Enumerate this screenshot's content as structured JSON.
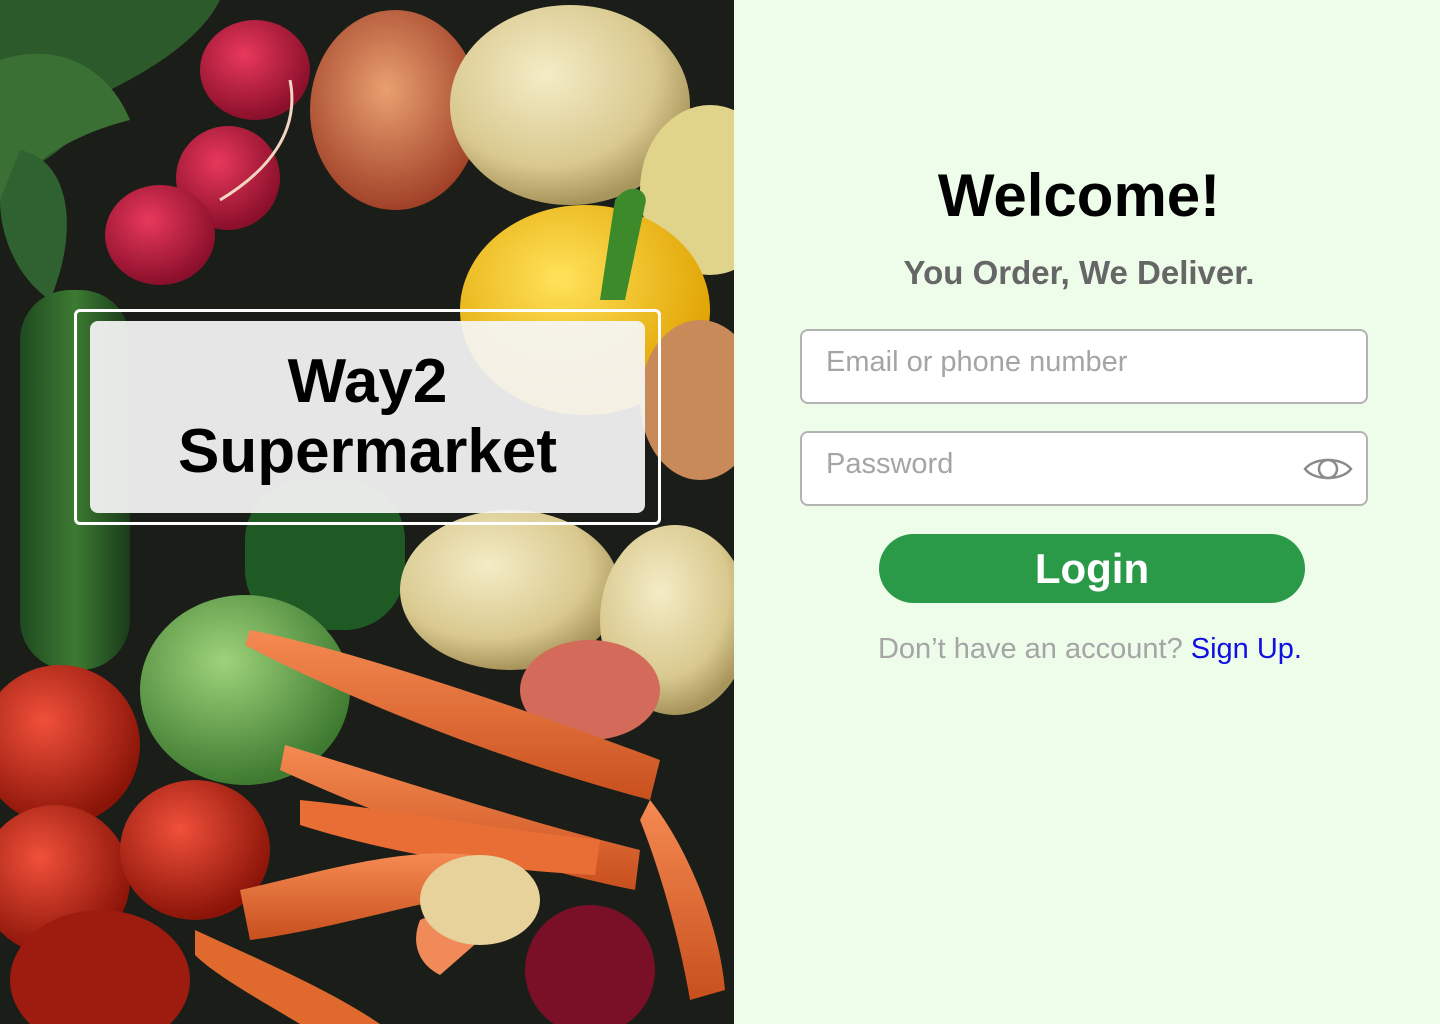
{
  "brand": {
    "line1": "Way2",
    "line2": "Supermarket"
  },
  "hero": {
    "image": "vegetables-photo"
  },
  "login": {
    "title": "Welcome!",
    "tagline": "You Order, We Deliver.",
    "email_placeholder": "Email or phone number",
    "password_placeholder": "Password",
    "password_toggle_icon": "eye-icon",
    "login_label": "Login",
    "signup_prompt": "Don’t have an account?",
    "signup_link": "Sign Up."
  },
  "colors": {
    "background": "#edfdea",
    "primary_button": "#2a9a48",
    "link": "#1010e0",
    "muted_text": "#a5a5a5",
    "tagline_text": "#666666"
  }
}
